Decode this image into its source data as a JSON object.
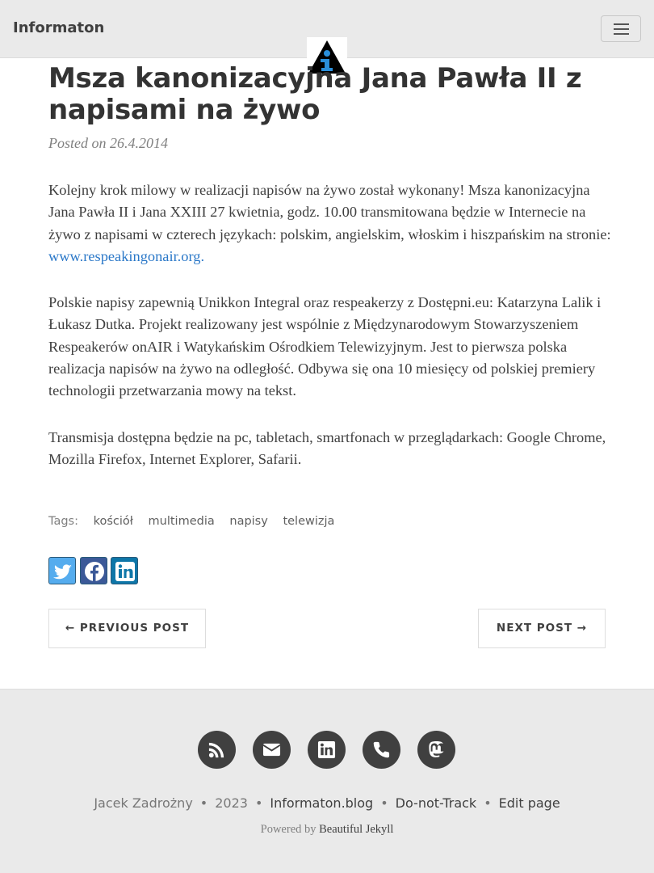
{
  "navbar": {
    "brand": "Informaton",
    "menu_icon": "hamburger-icon",
    "logo_icon": "info-warning-logo-icon"
  },
  "post": {
    "title": "Msza kanonizacyjna Jana Pawła II z napisami na żywo",
    "meta": "Posted on 26.4.2014",
    "p1_text": "Kolejny krok milowy w realizacji napisów na żywo został wykonany! Msza kanonizacyjna Jana Pawła II i Jana XXIII 27 kwietnia, godz. 10.00 transmitowana będzie w Internecie na żywo z napisami w czterech językach: polskim, angielskim, włoskim i hiszpańskim na stronie: ",
    "p1_link": "www.respeakingonair.org.",
    "p2": "Polskie napisy zapewnią Unikkon Integral oraz respeakerzy z Dostępni.eu: Katarzyna Lalik i Łukasz Dutka. Projekt realizowany jest wspólnie z Międzynarodowym Stowarzyszeniem Respeakerów onAIR i Watykańskim Ośrodkiem Telewizyjnym. Jest to pierwsza polska realizacja napisów na żywo na odległość. Odbywa się ona 10 miesięcy od polskiej premiery technologii przetwarzania mowy na tekst.",
    "p3": "Transmisja dostępna będzie na pc, tabletach, smartfonach w przeglądarkach: Google Chrome, Mozilla Firefox, Internet Explorer, Safarii."
  },
  "tags": {
    "label": "Tags:",
    "items": [
      "kościół",
      "multimedia",
      "napisy",
      "telewizja"
    ]
  },
  "share": {
    "icons": [
      "twitter-icon",
      "facebook-icon",
      "linkedin-icon"
    ],
    "color": "#5a8fc0"
  },
  "pager": {
    "previous": "← PREVIOUS POST",
    "next": "NEXT POST →"
  },
  "footer": {
    "social_icons": [
      "rss-icon",
      "envelope-icon",
      "linkedin-icon",
      "phone-icon",
      "mastodon-icon"
    ],
    "author": "Jacek Zadrożny",
    "year": "2023",
    "site": "Informaton.blog",
    "dnt": "Do-not-Track",
    "edit": "Edit page",
    "powered_prefix": "Powered by",
    "powered_link": "Beautiful Jekyll",
    "separator": "•"
  },
  "colors": {
    "nav_bg": "#eaeaea",
    "text": "#404040",
    "link": "#2b78c8",
    "muted": "#808080"
  }
}
